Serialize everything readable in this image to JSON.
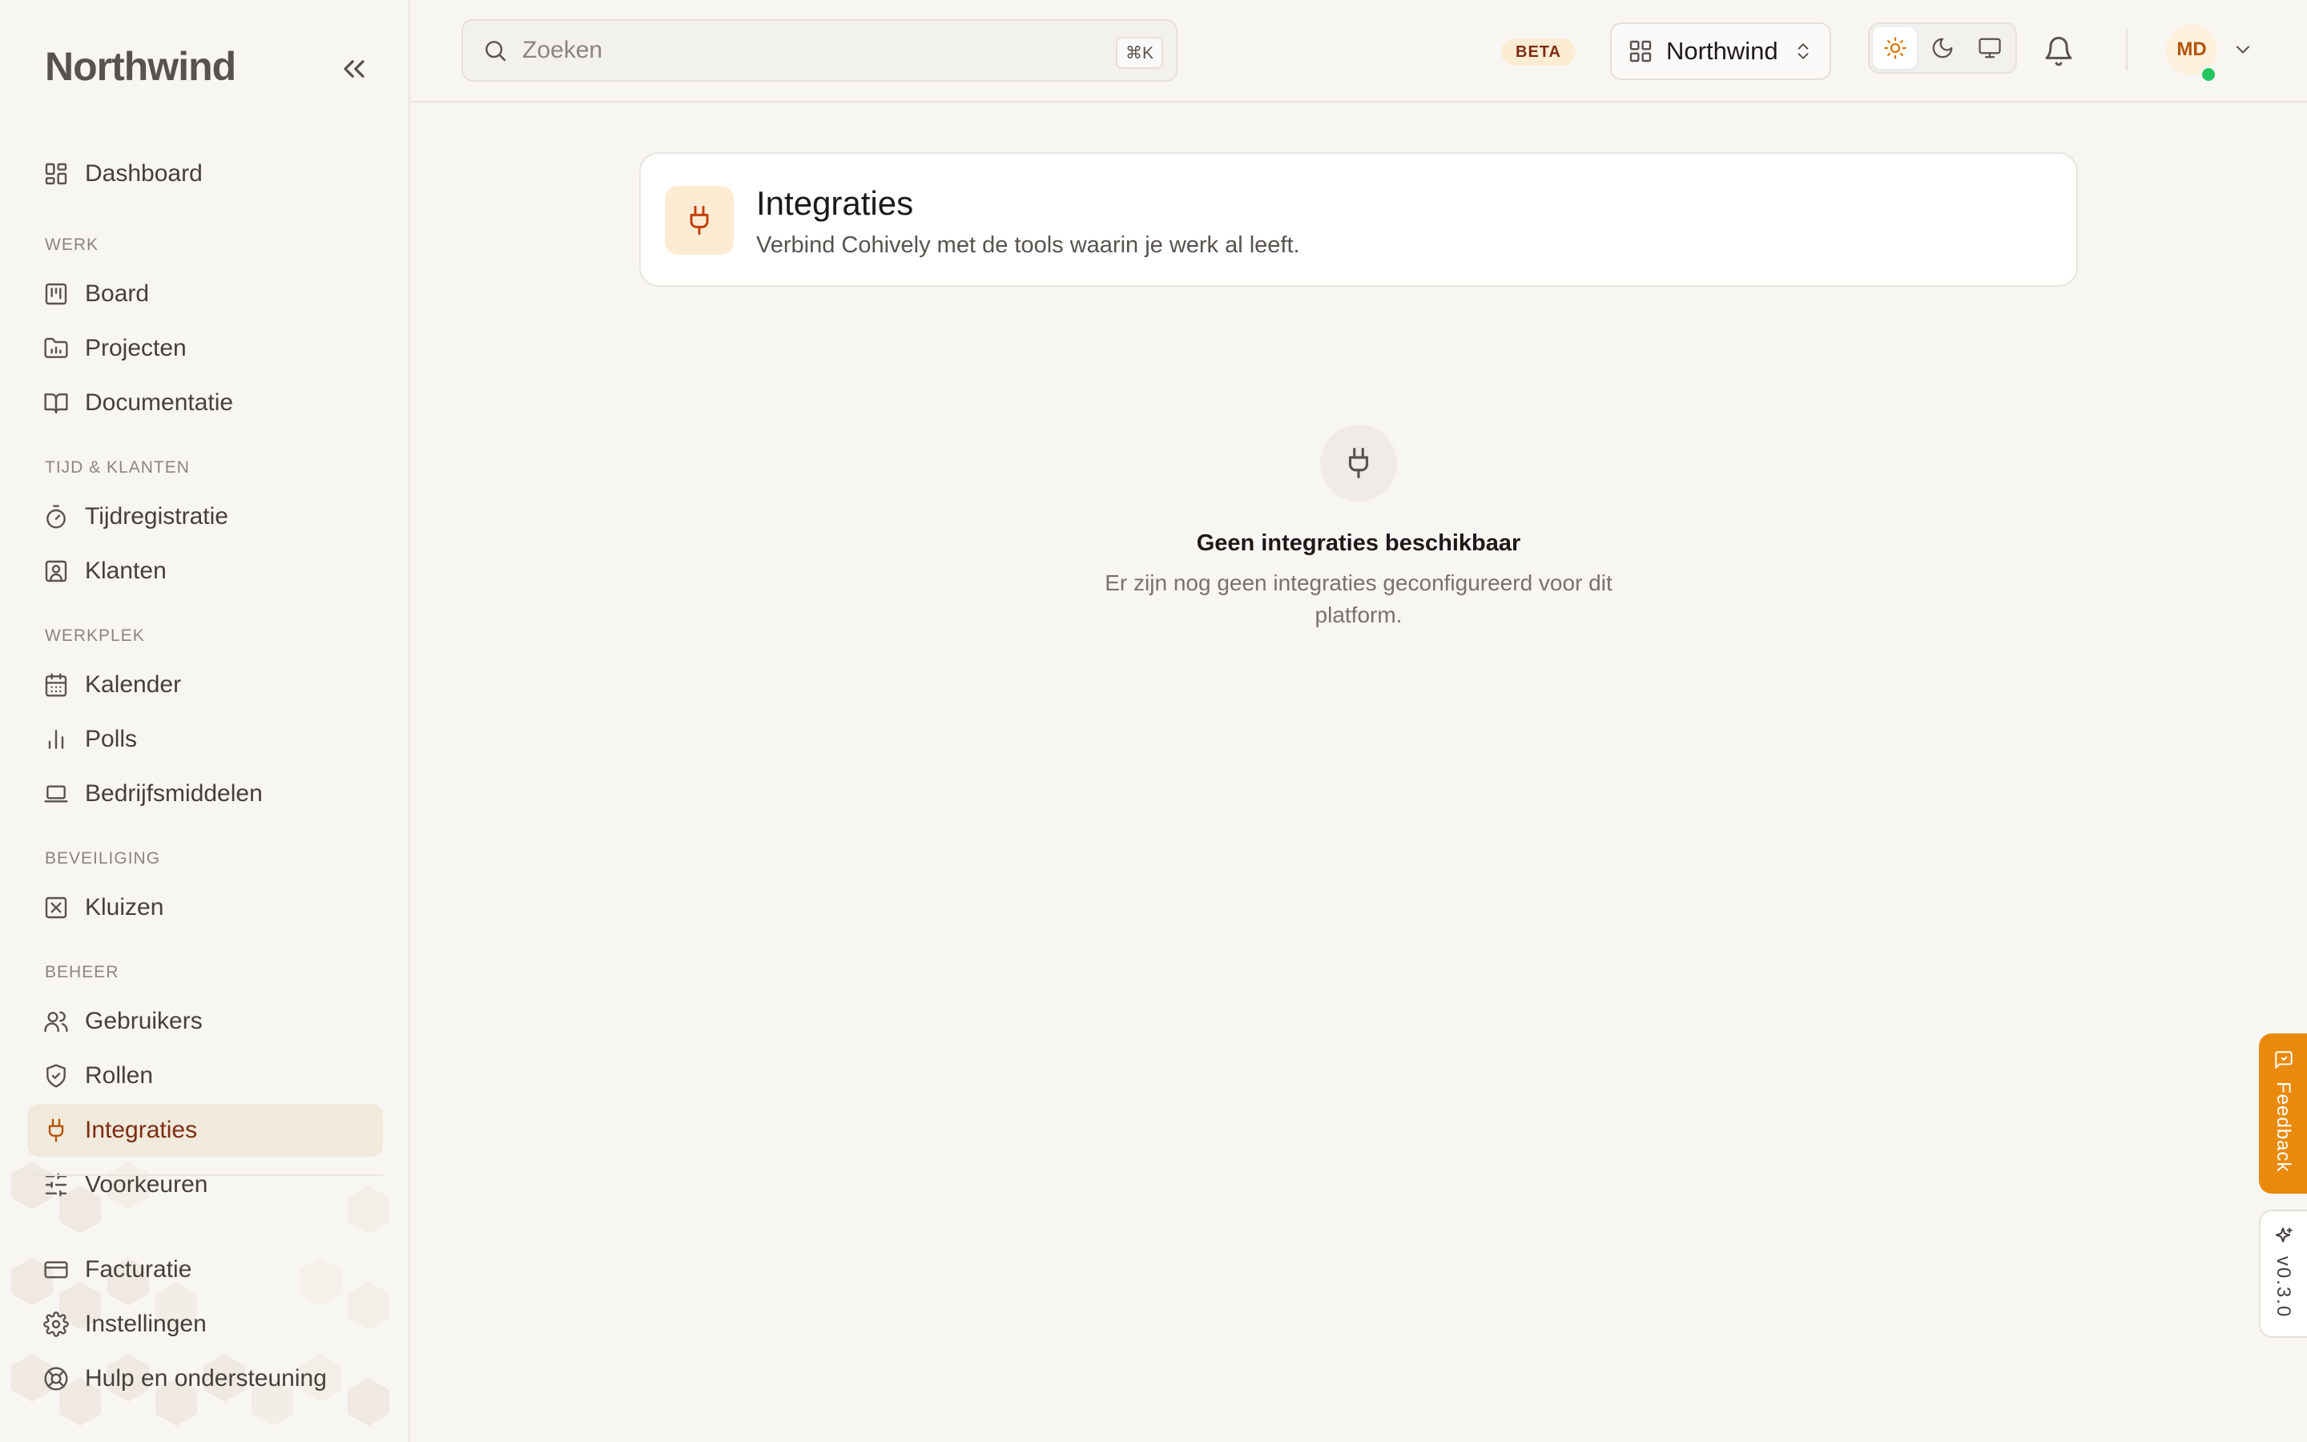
{
  "app": {
    "brand": "Northwind",
    "accent_color": "#ea8a0c"
  },
  "sidebar": {
    "collapse_icon": "chevrons-left-icon",
    "top_items": [
      {
        "label": "Dashboard",
        "icon": "layout-dashboard-icon"
      }
    ],
    "sections": [
      {
        "title": "WERK",
        "items": [
          {
            "label": "Board",
            "icon": "kanban-icon"
          },
          {
            "label": "Projecten",
            "icon": "folder-chart-icon"
          },
          {
            "label": "Documentatie",
            "icon": "book-open-icon"
          }
        ]
      },
      {
        "title": "TIJD & KLANTEN",
        "items": [
          {
            "label": "Tijdregistratie",
            "icon": "timer-icon"
          },
          {
            "label": "Klanten",
            "icon": "contact-icon"
          }
        ]
      },
      {
        "title": "WERKPLEK",
        "items": [
          {
            "label": "Kalender",
            "icon": "calendar-icon"
          },
          {
            "label": "Polls",
            "icon": "bar-chart-icon"
          },
          {
            "label": "Bedrijfsmiddelen",
            "icon": "laptop-icon"
          }
        ]
      },
      {
        "title": "BEVEILIGING",
        "items": [
          {
            "label": "Kluizen",
            "icon": "vault-icon"
          }
        ]
      },
      {
        "title": "BEHEER",
        "items": [
          {
            "label": "Gebruikers",
            "icon": "users-icon"
          },
          {
            "label": "Rollen",
            "icon": "shield-check-icon"
          },
          {
            "label": "Integraties",
            "icon": "plug-icon",
            "active": true
          },
          {
            "label": "Voorkeuren",
            "icon": "sliders-icon"
          }
        ]
      }
    ],
    "bottom_items": [
      {
        "label": "Facturatie",
        "icon": "credit-card-icon"
      },
      {
        "label": "Instellingen",
        "icon": "gear-icon"
      },
      {
        "label": "Hulp en ondersteuning",
        "icon": "life-buoy-icon"
      }
    ]
  },
  "topbar": {
    "search_placeholder": "Zoeken",
    "search_shortcut": "⌘K",
    "beta_badge": "BETA",
    "workspace": "Northwind",
    "theme_options": [
      {
        "name": "light",
        "icon": "sun-icon",
        "active": true
      },
      {
        "name": "dark",
        "icon": "moon-icon",
        "active": false
      },
      {
        "name": "system",
        "icon": "monitor-icon",
        "active": false
      }
    ],
    "notification_icon": "bell-icon",
    "user_initials": "MD",
    "user_status_color": "#22c55e"
  },
  "page": {
    "title": "Integraties",
    "subtitle": "Verbind Cohively met de tools waarin je werk al leeft.",
    "empty_title": "Geen integraties beschikbaar",
    "empty_text": "Er zijn nog geen integraties geconfigureerd voor dit platform."
  },
  "side_tabs": {
    "feedback": "Feedback",
    "version": "v0.3.0"
  }
}
